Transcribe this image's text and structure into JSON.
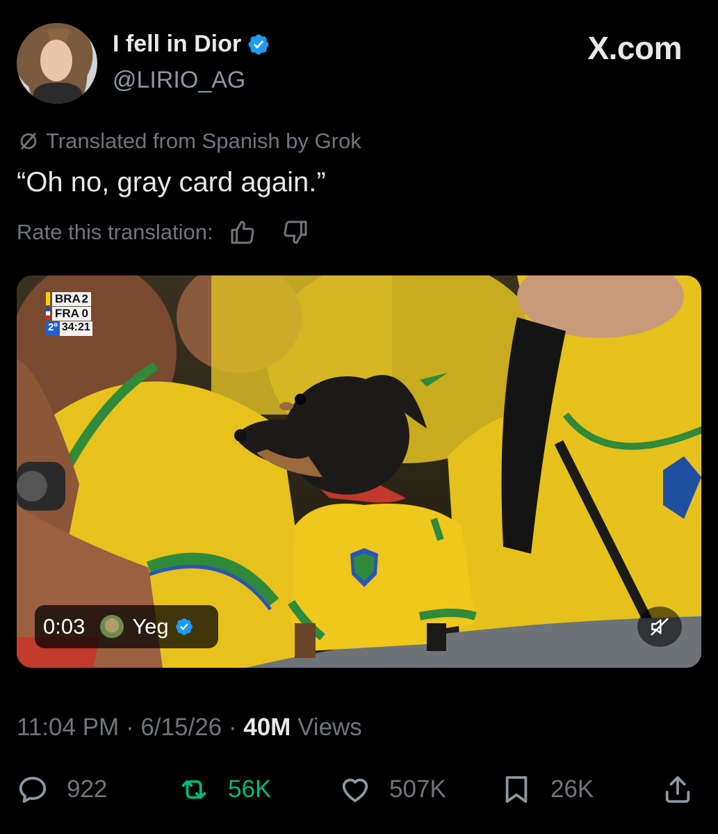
{
  "author": {
    "display_name": "I fell in Dior",
    "handle": "@LIRIO_AG",
    "verified": true,
    "avatar_icon": "profile-photo"
  },
  "watermark": "X.com",
  "translation": {
    "notice": "Translated from Spanish by Grok",
    "rate_label": "Rate this translation:"
  },
  "tweet": {
    "text": "“Oh no, gray card again.”"
  },
  "media": {
    "scoreboard": {
      "team1": "BRA",
      "score1": "2",
      "team2": "FRA",
      "score2": "0",
      "half": "2º",
      "clock": "34:21"
    },
    "video_time": "0:03",
    "creator_name": "Yeg",
    "creator_verified": true
  },
  "meta": {
    "time": "11:04 PM",
    "date": "6/15/26",
    "views_count": "40M",
    "views_label": "Views",
    "separator": "·"
  },
  "actions": {
    "replies": "922",
    "reposts": "56K",
    "likes": "507K",
    "bookmarks": "26K"
  },
  "colors": {
    "background": "#000000",
    "text_primary": "#e7e9ea",
    "text_secondary": "#71767b",
    "verified_blue": "#1d9bf0",
    "repost_green": "#00ba7c"
  }
}
